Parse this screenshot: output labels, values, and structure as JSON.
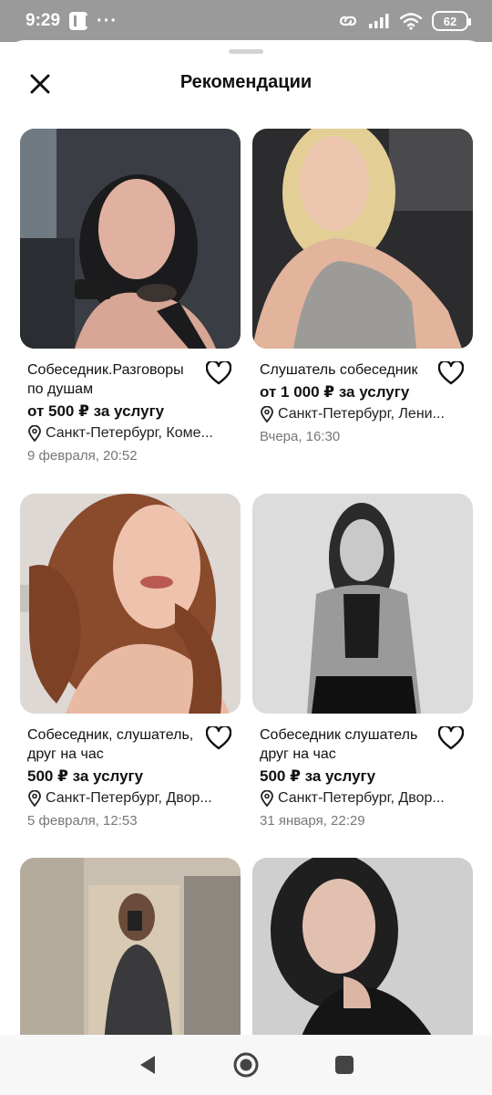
{
  "status": {
    "time": "9:29",
    "dots": "···",
    "battery": "62",
    "icons": [
      "app-badge-icon",
      "link-icon",
      "signal-icon",
      "wifi-icon",
      "battery-icon"
    ]
  },
  "sheet": {
    "title": "Рекомендации",
    "close_icon": "close-icon"
  },
  "cards": [
    {
      "title": "Собеседник.Разговоры по душам",
      "price": "от 500 ₽ за услугу",
      "location": "Санкт-Петербург, Коме...",
      "date": "9 февраля, 20:52"
    },
    {
      "title": "Слушатель собеседник",
      "price": "от 1 000 ₽ за услугу",
      "location": "Санкт-Петербург, Лени...",
      "date": "Вчера, 16:30"
    },
    {
      "title": "Собеседник, слушатель, друг на час",
      "price": "500 ₽ за услугу",
      "location": "Санкт-Петербург, Двор...",
      "date": "5 февраля, 12:53"
    },
    {
      "title": "Собеседник слушатель друг на час",
      "price": "500 ₽ за услугу",
      "location": "Санкт-Петербург, Двор...",
      "date": "31 января, 22:29"
    },
    {
      "title": "",
      "price": "",
      "location": "",
      "date": ""
    },
    {
      "title": "",
      "price": "",
      "location": "",
      "date": ""
    }
  ],
  "navbar": {
    "items": [
      "back-icon",
      "home-icon",
      "recents-icon"
    ]
  }
}
